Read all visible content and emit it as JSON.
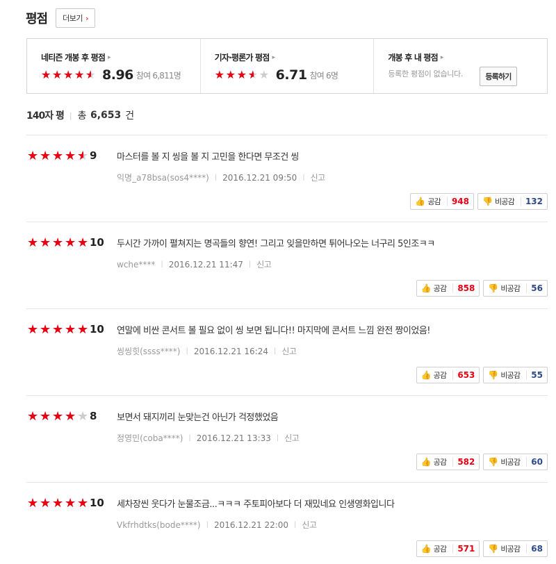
{
  "header": {
    "title": "평점",
    "more_label": "더보기",
    "more_icon": "chevron-right"
  },
  "summary": [
    {
      "label": "네티즌 개봉 후 평점",
      "stars": 4.5,
      "score": "8.96",
      "participants": "참여 6,811명"
    },
    {
      "label": "기자·평론가 평점",
      "stars": 3.5,
      "score": "6.71",
      "participants": "참여 6명"
    },
    {
      "label": "개봉 후 내 평점",
      "empty_text": "등록한 평점이 없습니다.",
      "register_label": "등록하기"
    }
  ],
  "list_header": {
    "title": "140자 평",
    "total_label": "총",
    "total_count": "6,653",
    "total_unit": "건"
  },
  "like_label": "공감",
  "dislike_label": "비공감",
  "report_label": "신고",
  "colors": {
    "accent": "#e60012",
    "star_empty": "#cccccc",
    "dislike_count": "#2c4a8a"
  },
  "reviews": [
    {
      "stars": 4.5,
      "score": "9",
      "text": "마스터를 볼 지 씽을 볼 지 고민을 한다면 무조건 씽",
      "author": "익명_a78bsa(sos4****)",
      "date": "2016.12.21 09:50",
      "likes": "948",
      "dislikes": "132"
    },
    {
      "stars": 5,
      "score": "10",
      "text": "두시간 가까이 펼쳐지는 명곡들의 향연! 그리고 잊을만하면 튀어나오는 너구리 5인조ㅋㅋ",
      "author": "wche****",
      "date": "2016.12.21 11:47",
      "likes": "858",
      "dislikes": "56"
    },
    {
      "stars": 5,
      "score": "10",
      "text": "연말에 비싼 콘서트 볼 필요 없이 씽 보면 됩니다!! 마지막에 콘서트 느낌 완전 짱이었음!",
      "author": "씽씽힛(ssss****)",
      "date": "2016.12.21 16:24",
      "likes": "653",
      "dislikes": "55"
    },
    {
      "stars": 4,
      "score": "8",
      "text": "보면서 돼지끼리 눈맞는건 아닌가 걱정했었음",
      "author": "정영민(coba****)",
      "date": "2016.12.21 13:33",
      "likes": "582",
      "dislikes": "60"
    },
    {
      "stars": 5,
      "score": "10",
      "text": "세차장씬 웃다가 눈물조금...ㅋㅋㅋ 주토피아보다 더 재밌네요 인생영화입니다",
      "author": "Vkfrhdtks(bode****)",
      "date": "2016.12.21 22:00",
      "likes": "571",
      "dislikes": "68"
    }
  ]
}
